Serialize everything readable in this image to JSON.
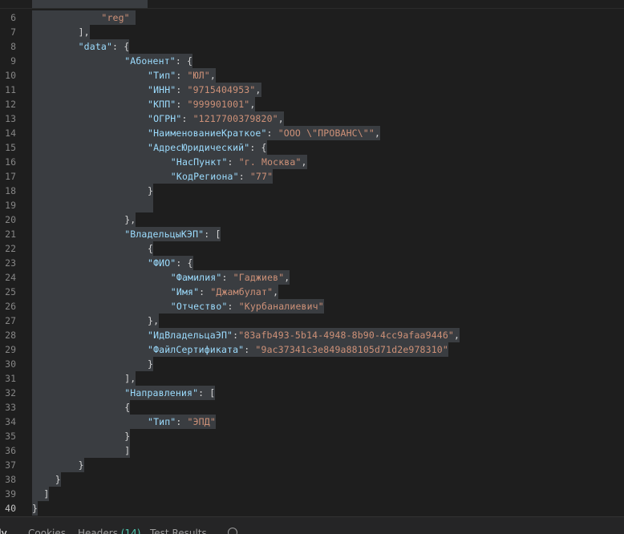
{
  "editor": {
    "lines": [
      {
        "n": "6",
        "indent": 6,
        "tokens": [
          [
            "s",
            "\"reg\""
          ],
          [
            "p",
            " "
          ]
        ]
      },
      {
        "n": "7",
        "indent": 4,
        "tokens": [
          [
            "p",
            "],"
          ]
        ]
      },
      {
        "n": "8",
        "indent": 4,
        "tokens": [
          [
            "k",
            "\"data\""
          ],
          [
            "p",
            ": {"
          ]
        ]
      },
      {
        "n": "9",
        "indent": 8,
        "tokens": [
          [
            "k",
            "\"Абонент\""
          ],
          [
            "p",
            ": {"
          ]
        ]
      },
      {
        "n": "10",
        "indent": 10,
        "tokens": [
          [
            "k",
            "\"Тип\""
          ],
          [
            "p",
            ": "
          ],
          [
            "s",
            "\"ЮЛ\""
          ],
          [
            "p",
            ","
          ]
        ]
      },
      {
        "n": "11",
        "indent": 10,
        "tokens": [
          [
            "k",
            "\"ИНН\""
          ],
          [
            "p",
            ": "
          ],
          [
            "s",
            "\"9715404953\""
          ],
          [
            "p",
            ","
          ]
        ]
      },
      {
        "n": "12",
        "indent": 10,
        "tokens": [
          [
            "k",
            "\"КПП\""
          ],
          [
            "p",
            ": "
          ],
          [
            "s",
            "\"999901001\""
          ],
          [
            "p",
            ","
          ]
        ]
      },
      {
        "n": "13",
        "indent": 10,
        "tokens": [
          [
            "k",
            "\"ОГРН\""
          ],
          [
            "p",
            ": "
          ],
          [
            "s",
            "\"1217700379820\""
          ],
          [
            "p",
            ","
          ]
        ]
      },
      {
        "n": "14",
        "indent": 10,
        "tokens": [
          [
            "k",
            "\"НаименованиеКраткое\""
          ],
          [
            "p",
            ": "
          ],
          [
            "s",
            "\"ООО \\\"ПРОВАНС\\\"\""
          ],
          [
            "p",
            ","
          ]
        ]
      },
      {
        "n": "15",
        "indent": 10,
        "tokens": [
          [
            "k",
            "\"АдресЮридический\""
          ],
          [
            "p",
            ": {"
          ]
        ]
      },
      {
        "n": "16",
        "indent": 12,
        "tokens": [
          [
            "k",
            "\"НасПункт\""
          ],
          [
            "p",
            ": "
          ],
          [
            "s",
            "\"г. Москва\""
          ],
          [
            "p",
            ","
          ]
        ]
      },
      {
        "n": "17",
        "indent": 12,
        "tokens": [
          [
            "k",
            "\"КодРегиона\""
          ],
          [
            "p",
            ": "
          ],
          [
            "s",
            "\"77\""
          ]
        ]
      },
      {
        "n": "18",
        "indent": 10,
        "tokens": [
          [
            "p",
            "}"
          ]
        ]
      },
      {
        "n": "19",
        "indent": 10,
        "tokens": [
          [
            "p",
            " "
          ]
        ]
      },
      {
        "n": "20",
        "indent": 8,
        "tokens": [
          [
            "p",
            "},"
          ]
        ]
      },
      {
        "n": "21",
        "indent": 8,
        "tokens": [
          [
            "k",
            "\"ВладельцыКЭП\""
          ],
          [
            "p",
            ": ["
          ]
        ]
      },
      {
        "n": "22",
        "indent": 10,
        "tokens": [
          [
            "p",
            "{"
          ]
        ]
      },
      {
        "n": "23",
        "indent": 10,
        "tokens": [
          [
            "k",
            "\"ФИО\""
          ],
          [
            "p",
            ": {"
          ]
        ]
      },
      {
        "n": "24",
        "indent": 12,
        "tokens": [
          [
            "k",
            "\"Фамилия\""
          ],
          [
            "p",
            ": "
          ],
          [
            "s",
            "\"Гаджиев\""
          ],
          [
            "p",
            ","
          ]
        ]
      },
      {
        "n": "25",
        "indent": 12,
        "tokens": [
          [
            "k",
            "\"Имя\""
          ],
          [
            "p",
            ": "
          ],
          [
            "s",
            "\"Джамбулат\""
          ],
          [
            "p",
            ","
          ]
        ]
      },
      {
        "n": "26",
        "indent": 12,
        "tokens": [
          [
            "k",
            "\"Отчество\""
          ],
          [
            "p",
            ": "
          ],
          [
            "s",
            "\"Курбаналиевич\""
          ]
        ]
      },
      {
        "n": "27",
        "indent": 10,
        "tokens": [
          [
            "p",
            "},"
          ]
        ]
      },
      {
        "n": "28",
        "indent": 10,
        "tokens": [
          [
            "k",
            "\"ИдВладельцаЭП\""
          ],
          [
            "p",
            ":"
          ],
          [
            "s",
            "\"83afb493-5b14-4948-8b90-4cc9afaa9446\""
          ],
          [
            "p",
            ","
          ]
        ]
      },
      {
        "n": "29",
        "indent": 10,
        "tokens": [
          [
            "k",
            "\"ФайлСертификата\""
          ],
          [
            "p",
            ": "
          ],
          [
            "s",
            "\"9ac37341c3e849a88105d71d2e978310\""
          ]
        ]
      },
      {
        "n": "30",
        "indent": 10,
        "tokens": [
          [
            "p",
            "}"
          ]
        ]
      },
      {
        "n": "31",
        "indent": 8,
        "tokens": [
          [
            "p",
            "],"
          ]
        ]
      },
      {
        "n": "32",
        "indent": 8,
        "tokens": [
          [
            "k",
            "\"Направления\""
          ],
          [
            "p",
            ": ["
          ]
        ]
      },
      {
        "n": "33",
        "indent": 8,
        "tokens": [
          [
            "p",
            "{"
          ]
        ]
      },
      {
        "n": "34",
        "indent": 10,
        "tokens": [
          [
            "k",
            "\"Тип\""
          ],
          [
            "p",
            ": "
          ],
          [
            "s",
            "\"ЭПД\""
          ]
        ]
      },
      {
        "n": "35",
        "indent": 8,
        "tokens": [
          [
            "p",
            "}"
          ]
        ]
      },
      {
        "n": "36",
        "indent": 8,
        "tokens": [
          [
            "p",
            "]"
          ]
        ]
      },
      {
        "n": "37",
        "indent": 4,
        "tokens": [
          [
            "p",
            "}"
          ]
        ]
      },
      {
        "n": "38",
        "indent": 2,
        "tokens": [
          [
            "p",
            "}"
          ]
        ]
      },
      {
        "n": "39",
        "indent": 1,
        "tokens": [
          [
            "p",
            "]"
          ]
        ]
      },
      {
        "n": "40",
        "indent": 0,
        "tokens": [
          [
            "p",
            "}"
          ]
        ]
      }
    ],
    "active_line": "40"
  },
  "bottom_tabs": [
    {
      "label": "dy"
    },
    {
      "label": "Cookies"
    },
    {
      "label": "Headers",
      "count": "(14)"
    },
    {
      "label": "Test Results"
    }
  ],
  "colors": {
    "background": "#1e1e1e",
    "selection": "#3a3d41",
    "key": "#9cdcfe",
    "string": "#ce9178",
    "punctuation": "#d4d4d4",
    "line_number": "#858585",
    "count": "#4ec9b0"
  }
}
